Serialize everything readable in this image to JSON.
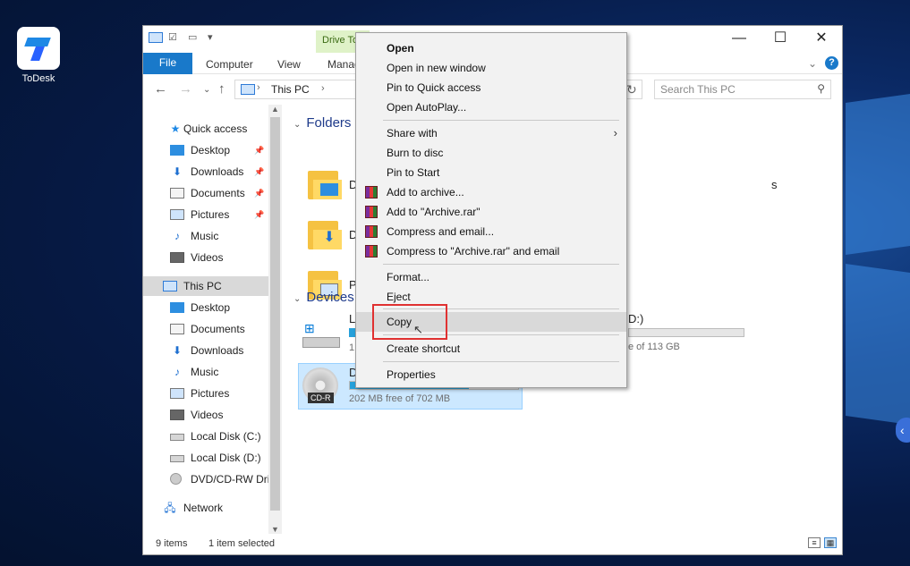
{
  "desktop": {
    "icon_label": "ToDesk"
  },
  "window": {
    "context_tab": "Drive To",
    "controls": {
      "minimize": "—",
      "maximize": "☐",
      "close": "✕"
    }
  },
  "ribbon": {
    "file": "File",
    "computer": "Computer",
    "view": "View",
    "manage": "Manag"
  },
  "address": {
    "location": "This PC",
    "search_placeholder": "Search This PC"
  },
  "nav": {
    "quick_access": "Quick access",
    "qa_items": [
      {
        "label": "Desktop"
      },
      {
        "label": "Downloads"
      },
      {
        "label": "Documents"
      },
      {
        "label": "Pictures"
      },
      {
        "label": "Music"
      },
      {
        "label": "Videos"
      }
    ],
    "this_pc": "This PC",
    "pc_items": [
      {
        "label": "Desktop"
      },
      {
        "label": "Documents"
      },
      {
        "label": "Downloads"
      },
      {
        "label": "Music"
      },
      {
        "label": "Pictures"
      },
      {
        "label": "Videos"
      },
      {
        "label": "Local Disk (C:)"
      },
      {
        "label": "Local Disk (D:)"
      },
      {
        "label": "DVD/CD-RW Dri"
      }
    ],
    "network": "Network"
  },
  "content": {
    "folders_head": "Folders (",
    "devices_head": "Devices a",
    "folder_letters": [
      "D",
      "D",
      "P"
    ],
    "folder_partial_suffix": "s",
    "drive_c_letter": "L",
    "drive_c_free_start": "1",
    "drive_d_label": "D:)",
    "drive_d_free": "e of 113 GB",
    "cd_letter": "D",
    "cd_badge": "CD-R",
    "cd_free": "202 MB free of 702 MB",
    "cd_fill_pct": 0.71
  },
  "status": {
    "items": "9 items",
    "selected": "1 item selected"
  },
  "context_menu": {
    "items": [
      {
        "label": "Open",
        "bold": true
      },
      {
        "label": "Open in new window"
      },
      {
        "label": "Pin to Quick access"
      },
      {
        "label": "Open AutoPlay..."
      },
      {
        "label": "Share with",
        "submenu": true
      },
      {
        "label": "Burn to disc"
      },
      {
        "label": "Pin to Start"
      },
      {
        "label": "Add to archive...",
        "icon": "rar"
      },
      {
        "label": "Add to \"Archive.rar\"",
        "icon": "rar"
      },
      {
        "label": "Compress and email...",
        "icon": "rar"
      },
      {
        "label": "Compress to \"Archive.rar\" and email",
        "icon": "rar"
      },
      {
        "label": "Format..."
      },
      {
        "label": "Eject"
      },
      {
        "label": "Copy",
        "highlighted": true
      },
      {
        "label": "Create shortcut"
      },
      {
        "label": "Properties"
      }
    ]
  },
  "colors": {
    "accent": "#1979ca",
    "highlight_box": "#e03131",
    "selection": "#cce8ff"
  }
}
